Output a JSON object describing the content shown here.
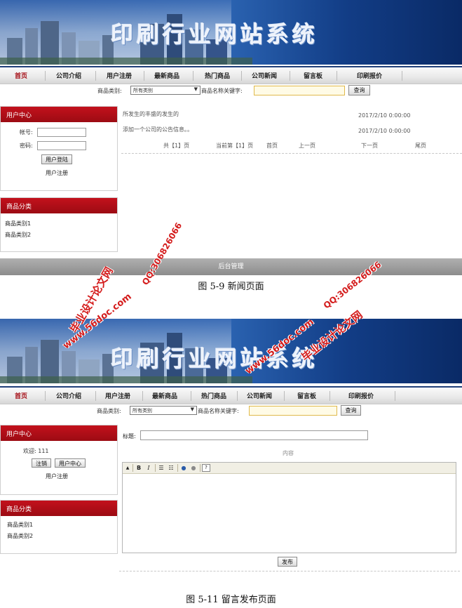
{
  "site_title": "印刷行业网站系统",
  "nav": [
    "首页",
    "公司介绍",
    "用户注册",
    "最新商品",
    "热门商品",
    "公司新闻",
    "留言板",
    "印刷报价"
  ],
  "search": {
    "category_label": "商品类别:",
    "category_value": "所有类别",
    "keyword_label": "商品名称关键字:",
    "submit": "查询"
  },
  "shot1": {
    "user_center": {
      "title": "用户中心",
      "account_label": "帐号:",
      "password_label": "密码:",
      "login_button": "用户登陆",
      "register_link": "用户注册"
    },
    "categories": {
      "title": "商品分类",
      "items": [
        "商品类别1",
        "商品类别2"
      ]
    },
    "news": [
      {
        "title": "所发生的丰盛的发生的",
        "date": "2017/2/10 0:00:00"
      },
      {
        "title": "添加一个公司的公告信息。。",
        "date": "2017/2/10 0:00:00"
      }
    ],
    "pager": {
      "total": "共【1】页",
      "current": "当前第【1】页",
      "first": "首页",
      "prev": "上一页",
      "next": "下一页",
      "last": "尾页"
    },
    "footer": "后台管理",
    "caption": "图 5-9 新闻页面"
  },
  "shot2": {
    "user_center": {
      "title": "用户中心",
      "welcome": "欢迎: 111",
      "logout_button": "注销",
      "center_button": "用户中心",
      "register_link": "用户注册"
    },
    "categories": {
      "title": "商品分类",
      "items": [
        "商品类别1",
        "商品类别2"
      ]
    },
    "form": {
      "title_label": "标题:",
      "content_label": "内容",
      "submit": "发布"
    },
    "caption": "图 5-11 留言发布页面"
  },
  "watermarks": [
    "毕业设计论文网",
    "QQ:306826066",
    "www.56doc.com"
  ]
}
